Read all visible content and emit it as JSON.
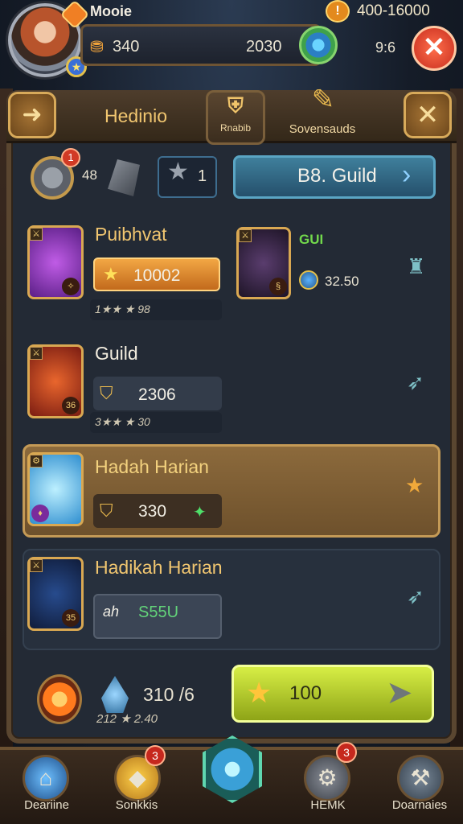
{
  "player": {
    "name": "Mooie"
  },
  "resources": {
    "res1": "340",
    "res2": "2030",
    "gold": "400-16000",
    "time": "9:6"
  },
  "header": {
    "title": "Hedinio",
    "tab1_label": "Rnabib",
    "tab2_label": "Sovensauds"
  },
  "stats": {
    "coin_value": "48",
    "coin_badge": "1",
    "star_value": "1",
    "guild_button": "B8. Guild"
  },
  "rows": [
    {
      "title": "Puibhvat",
      "pill_value": "10002",
      "sub": "1★★ ★ 98",
      "tag": "GUI",
      "mini_value": "32.50"
    },
    {
      "title": "Guild",
      "pill_value": "2306",
      "sub": "3★★ ★ 30"
    },
    {
      "title": "Hadah Harian",
      "pill_value": "330"
    },
    {
      "title": "Hadikah Harian",
      "pill_value": "S55U",
      "pill_prefix": "ah"
    }
  ],
  "bottom": {
    "value1": "310 /6",
    "value2": "212 ★ 2.40",
    "buy_label": "100"
  },
  "nav": [
    {
      "label": "Deariine",
      "badge": ""
    },
    {
      "label": "Sonkkis",
      "badge": "3"
    },
    {
      "label": "",
      "badge": ""
    },
    {
      "label": "HEMK",
      "badge": "3"
    },
    {
      "label": "Doarnaies",
      "badge": ""
    }
  ]
}
